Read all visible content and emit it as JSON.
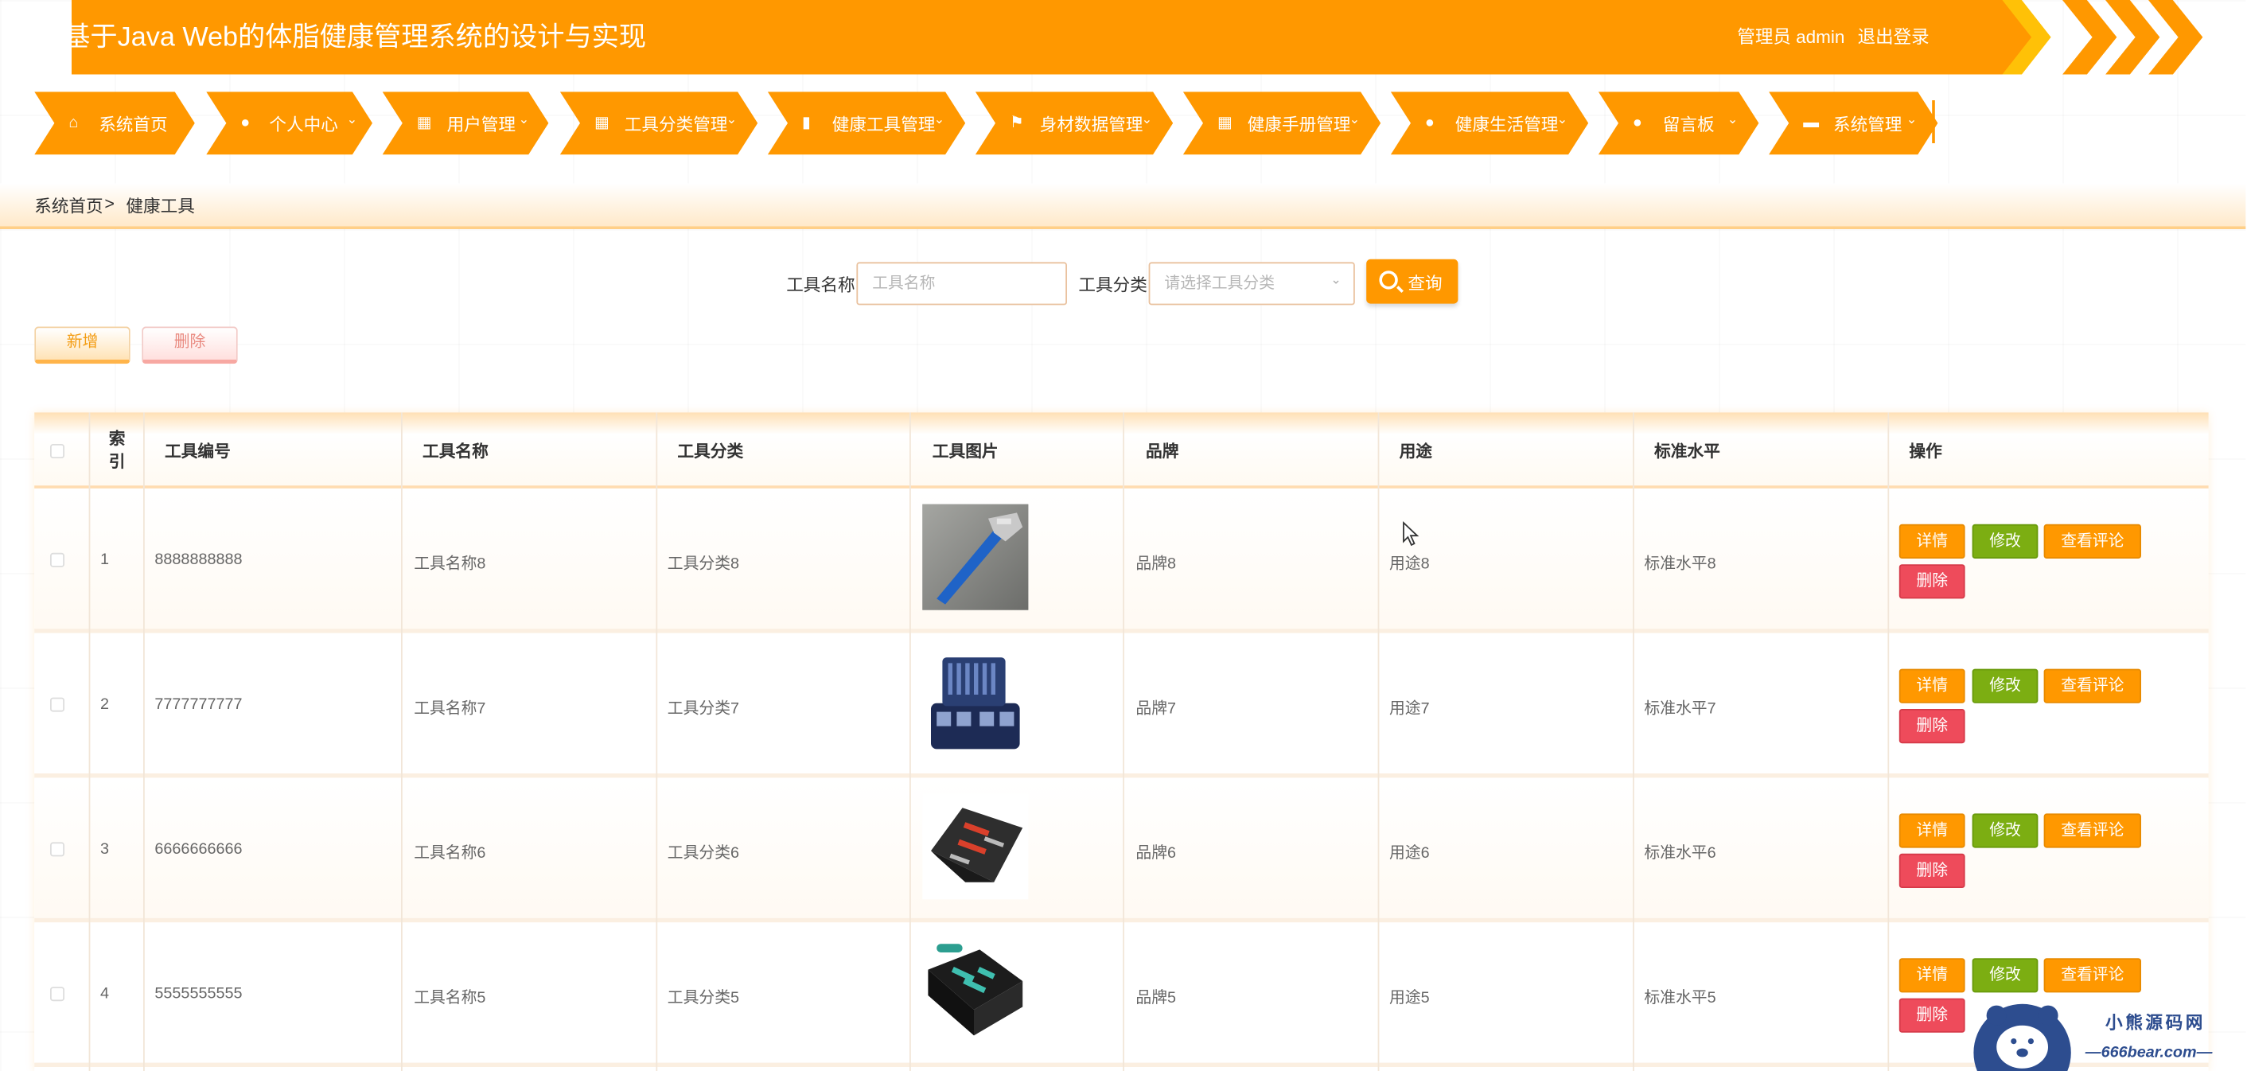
{
  "header": {
    "title": "基于Java Web的体脂健康管理系统的设计与实现",
    "user_text": "管理员 admin",
    "logout_label": "退出登录"
  },
  "nav": {
    "items": [
      {
        "label": "系统首页",
        "icon": "home-icon",
        "dropdown": false
      },
      {
        "label": "个人中心",
        "icon": "user-icon",
        "dropdown": true
      },
      {
        "label": "用户管理",
        "icon": "grid-icon",
        "dropdown": true
      },
      {
        "label": "工具分类管理",
        "icon": "grid-icon",
        "dropdown": true
      },
      {
        "label": "健康工具管理",
        "icon": "bar-chart-icon",
        "dropdown": true
      },
      {
        "label": "身材数据管理",
        "icon": "flag-icon",
        "dropdown": true
      },
      {
        "label": "健康手册管理",
        "icon": "grid-icon",
        "dropdown": true
      },
      {
        "label": "健康生活管理",
        "icon": "user-icon",
        "dropdown": true
      },
      {
        "label": "留言板",
        "icon": "pin-icon",
        "dropdown": true
      },
      {
        "label": "系统管理",
        "icon": "printer-icon",
        "dropdown": true
      }
    ]
  },
  "breadcrumb": {
    "home": "系统首页",
    "separator": ">",
    "current": "健康工具"
  },
  "search": {
    "name_label": "工具名称",
    "name_placeholder": "工具名称",
    "category_label": "工具分类",
    "category_placeholder": "请选择工具分类",
    "query_label": "查询"
  },
  "actions": {
    "add_label": "新增",
    "delete_label": "删除"
  },
  "table": {
    "headers": {
      "index": "索引",
      "code": "工具编号",
      "name": "工具名称",
      "category": "工具分类",
      "image": "工具图片",
      "brand": "品牌",
      "usage": "用途",
      "standard": "标准水平",
      "ops": "操作"
    },
    "row_buttons": {
      "detail": "详情",
      "edit": "修改",
      "review": "查看评论",
      "delete": "删除"
    },
    "rows": [
      {
        "index": "1",
        "code": "8888888888",
        "name": "工具名称8",
        "category": "工具分类8",
        "image": "pipe-wrench",
        "brand": "品牌8",
        "usage": "用途8",
        "standard": "标准水平8"
      },
      {
        "index": "2",
        "code": "7777777777",
        "name": "工具名称7",
        "category": "工具分类7",
        "image": "screwdriver-set",
        "brand": "品牌7",
        "usage": "用途7",
        "standard": "标准水平7"
      },
      {
        "index": "3",
        "code": "6666666666",
        "name": "工具名称6",
        "category": "工具分类6",
        "image": "tool-kit-case",
        "brand": "品牌6",
        "usage": "用途6",
        "standard": "标准水平6"
      },
      {
        "index": "4",
        "code": "5555555555",
        "name": "工具名称5",
        "category": "工具分类5",
        "image": "green-tool-kit",
        "brand": "品牌5",
        "usage": "用途5",
        "standard": "标准水平5"
      }
    ]
  },
  "watermark": {
    "title": "小熊源码网",
    "url": "666bear.com"
  },
  "colors": {
    "primary": "#ff9800",
    "secondary": "#ffc107",
    "edit": "#7cae12",
    "danger": "#ee4b5b"
  }
}
